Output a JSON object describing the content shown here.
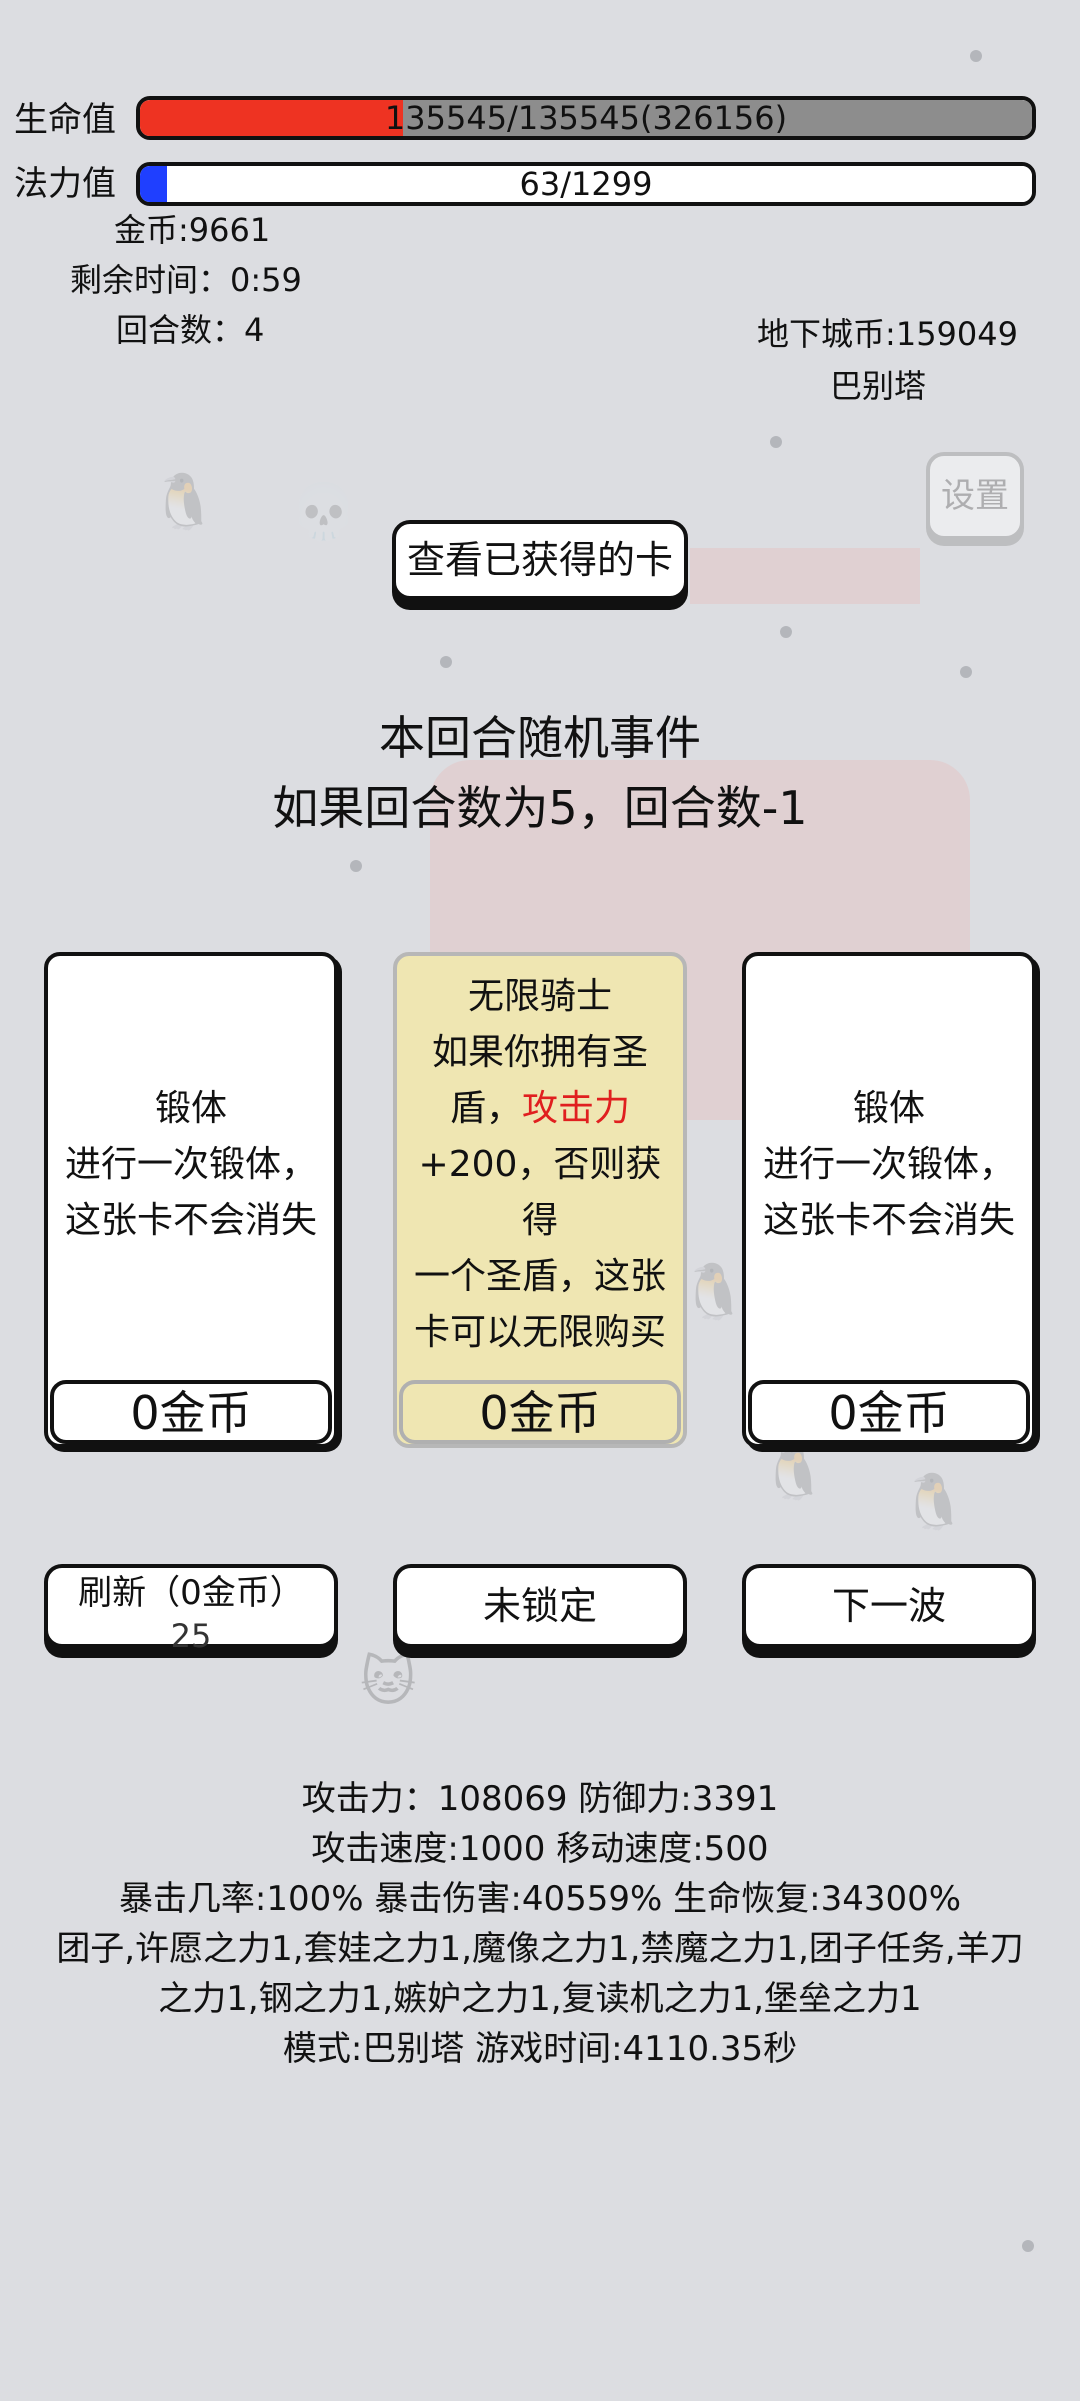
{
  "header": {
    "hp": {
      "label": "生命值",
      "text": "135545/135545(326156)",
      "fill_fraction": 0.295,
      "fill_color": "#ee3322",
      "rest_color": "#8d8d8d"
    },
    "mp": {
      "label": "法力值",
      "text": "63/1299",
      "fill_fraction": 0.03,
      "fill_color": "#1f3fff",
      "rest_color": "#ffffff"
    }
  },
  "stats": {
    "gold": "金币:9661",
    "time_left": "剩余时间：0:59",
    "rounds": "回合数：4",
    "dungeon_coins": "地下城币:159049",
    "location": "巴别塔"
  },
  "settings_label": "设置",
  "view_cards_label": "查看已获得的卡",
  "event": {
    "title": "本回合随机事件",
    "desc": "如果回合数为5，回合数-1"
  },
  "cards": [
    {
      "name": "锻体",
      "lines": [
        "进行一次锻体，",
        "这张卡不会消失"
      ],
      "price": "0金币"
    },
    {
      "name": "无限骑士",
      "line1": "如果你拥有圣",
      "line2a": "盾，",
      "line2b": "攻击力",
      "line3": "+200，否则获得",
      "line4": "一个圣盾，这张",
      "line5": "卡可以无限购买",
      "price": "0金币"
    },
    {
      "name": "锻体",
      "lines": [
        "进行一次锻体，",
        "这张卡不会消失"
      ],
      "price": "0金币"
    }
  ],
  "actions": {
    "refresh_label": "刷新（0金币）",
    "refresh_count": "25",
    "lock_label": "未锁定",
    "next_label": "下一波"
  },
  "info": {
    "line1": "攻击力：108069 防御力:3391",
    "line2": "攻击速度:1000 移动速度:500",
    "line3": "暴击几率:100% 暴击伤害:40559% 生命恢复:34300%",
    "line4": "团子,许愿之力1,套娃之力1,魔像之力1,禁魔之力1,团子任务,羊刀",
    "line5": "之力1,钢之力1,嫉妒之力1,复读机之力1,堡垒之力1",
    "line6": "模式:巴别塔 游戏时间:4110.35秒"
  }
}
